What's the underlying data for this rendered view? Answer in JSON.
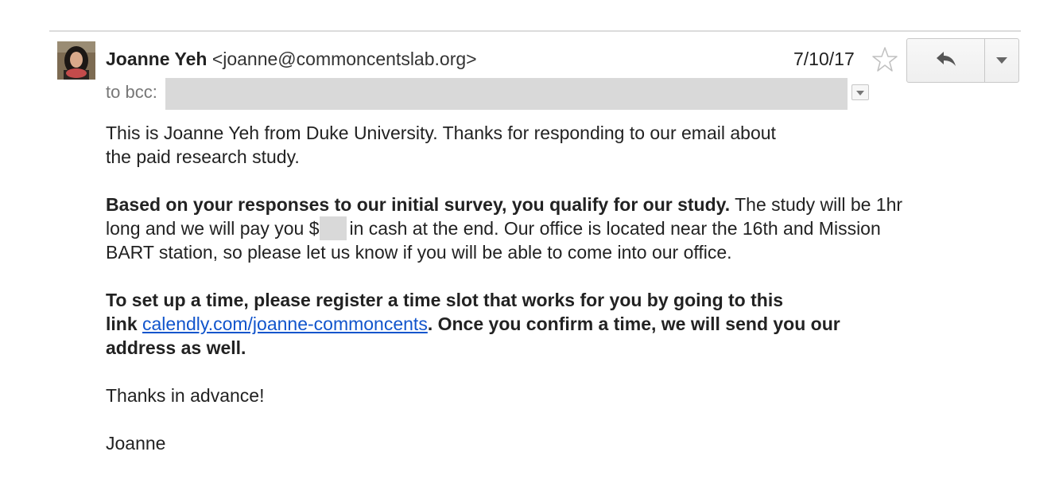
{
  "header": {
    "sender_name": "Joanne Yeh",
    "sender_email": "<joanne@commoncentslab.org>",
    "date": "7/10/17",
    "recipients_label": "to bcc:",
    "star_icon": "star-outline-icon",
    "reply_icon": "reply-arrow-icon",
    "more_icon": "dropdown-triangle-icon"
  },
  "body": {
    "p1_line1": "This is Joanne Yeh from Duke University. Thanks for responding to our email about",
    "p1_line2": "the paid research study.",
    "p2_bold": "Based on your responses to our initial survey, you qualify for our study.",
    "p2_line1_rest": " The study will be 1hr",
    "p2_line2_pre": "long and we will pay you $",
    "p2_line2_post": "in cash at the end. Our office is located near the 16th and Mission",
    "p2_line3": "BART station, so please let us know if you will be able to come into our office.",
    "p3_line1": "To set up a time, please register a time slot that works for you by going to this",
    "p3_line2_pre": "link ",
    "p3_link": "calendly.com/joanne-commoncents",
    "p3_line2_post": ". Once you confirm a time, we will send you our",
    "p3_line3": "address as well.",
    "p4": "Thanks in advance!",
    "signature": "Joanne"
  },
  "colors": {
    "link": "#1155cc",
    "redaction": "#d9d9d9",
    "muted_text": "#777777"
  }
}
